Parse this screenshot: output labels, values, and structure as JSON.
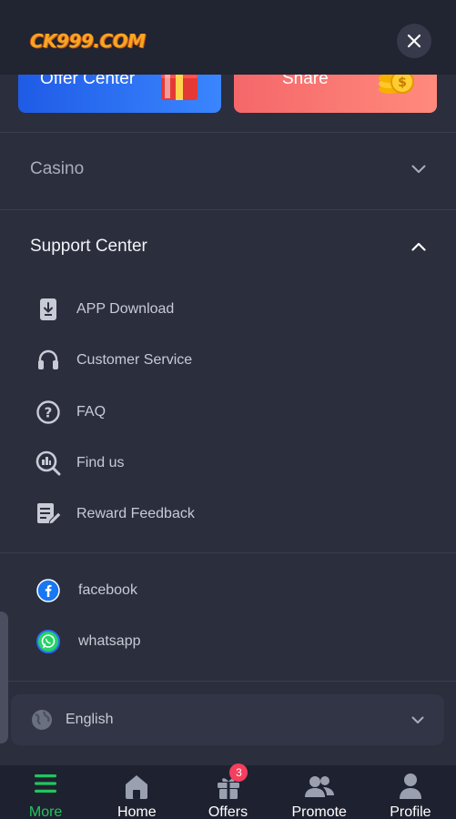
{
  "header": {
    "logo_text": "CK999.COM"
  },
  "banners": [
    {
      "label": "Offer Center",
      "color": "#2a6df4"
    },
    {
      "label": "Share",
      "color": "#f87171"
    }
  ],
  "sections": {
    "casino": {
      "title": "Casino",
      "expanded": false
    },
    "support": {
      "title": "Support Center",
      "expanded": true,
      "items": [
        {
          "label": "APP Download",
          "icon": "download-icon"
        },
        {
          "label": "Customer Service",
          "icon": "headset-icon"
        },
        {
          "label": "FAQ",
          "icon": "question-icon"
        },
        {
          "label": "Find us",
          "icon": "find-us-icon"
        },
        {
          "label": "Reward Feedback",
          "icon": "feedback-icon"
        }
      ]
    }
  },
  "social": [
    {
      "label": "facebook",
      "icon": "facebook-icon"
    },
    {
      "label": "whatsapp",
      "icon": "whatsapp-icon"
    }
  ],
  "language": {
    "value": "English"
  },
  "nav": {
    "items": [
      {
        "label": "More",
        "active": true
      },
      {
        "label": "Home",
        "active": false
      },
      {
        "label": "Offers",
        "active": false,
        "badge": "3"
      },
      {
        "label": "Promote",
        "active": false
      },
      {
        "label": "Profile",
        "active": false
      }
    ]
  },
  "colors": {
    "accent": "#22c55e",
    "badge": "#f43f5e",
    "background": "#2b2e3d"
  }
}
